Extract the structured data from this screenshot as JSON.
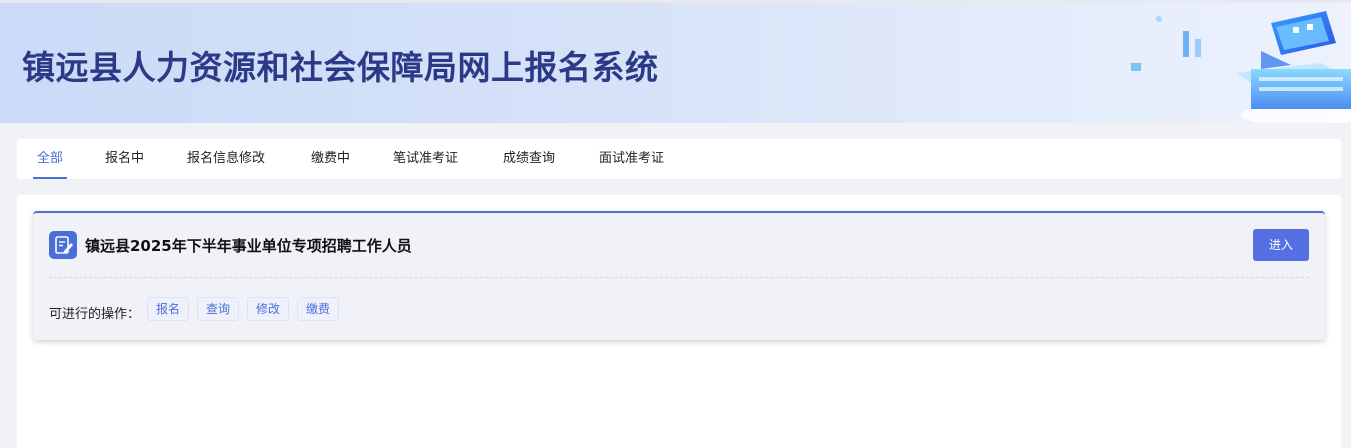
{
  "header": {
    "title": "镇远县人力资源和社会保障局网上报名系统"
  },
  "tabs": [
    {
      "label": "全部",
      "active": true
    },
    {
      "label": "报名中",
      "active": false
    },
    {
      "label": "报名信息修改",
      "active": false
    },
    {
      "label": "缴费中",
      "active": false
    },
    {
      "label": "笔试准考证",
      "active": false
    },
    {
      "label": "成绩查询",
      "active": false
    },
    {
      "label": "面试准考证",
      "active": false
    }
  ],
  "exam_card": {
    "title": "镇远县2025年下半年事业单位专项招聘工作人员",
    "enter_label": "进入",
    "operations_label": "可进行的操作：",
    "operations": [
      "报名",
      "查询",
      "修改",
      "缴费"
    ],
    "icon": "edit-document-icon"
  },
  "colors": {
    "accent": "#4a6fd8",
    "button": "#5470e2",
    "title_text": "#2b3a86"
  }
}
